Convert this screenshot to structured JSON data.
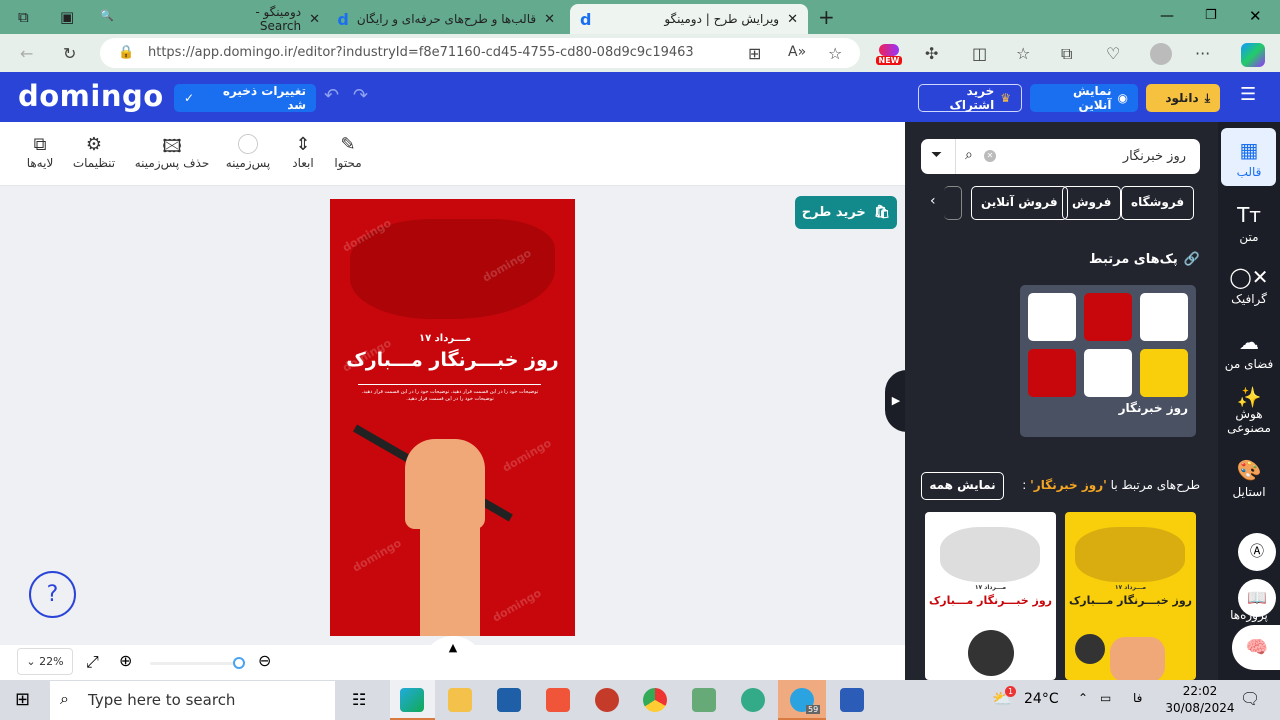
{
  "browser": {
    "tabs": [
      {
        "label": "دومینگو - Search",
        "active": false
      },
      {
        "label": "قالب‌ها و طرح‌های حرفه‌ای و رایگان",
        "active": false
      },
      {
        "label": "ویرایش طرح | دومینگو",
        "active": true
      }
    ],
    "url": "https://app.domingo.ir/editor?industryId=f8e71160-cd45-4755-cd80-08d9c9c19463",
    "url_host": "app.domingo.ir",
    "new_badge": "NEW"
  },
  "header": {
    "logo": "domingo",
    "saved": "تغییرات ذخیره شد",
    "download": "دانلود",
    "preview": "نمایش آنلاین",
    "subscribe": "خرید اشتراک"
  },
  "toolbar": [
    {
      "label": "محتوا",
      "icon": "pencil-icon"
    },
    {
      "label": "ابعاد",
      "icon": "resize-icon"
    },
    {
      "label": "پس‌زمینه",
      "icon": "background-color-icon"
    },
    {
      "label": "حذف پس‌زمینه",
      "icon": "remove-background-icon"
    },
    {
      "label": "تنظیمات",
      "icon": "gear-icon"
    },
    {
      "label": "لایه‌ها",
      "icon": "layers-icon"
    }
  ],
  "canvas": {
    "buy_design": "خرید طرح",
    "design": {
      "date": "۱۷ مـــرداد",
      "title": "روز خبـــرنگار مـــبارک",
      "body": "توضیحات خود را در این قسمت قرار دهید. توضیحات خود را در این قسمت قرار دهید. توضیحات خود را در این قسمت قرار دهید.",
      "watermark": "domingo",
      "bg_color": "#c8070c"
    },
    "help": "?",
    "zoom": "22%",
    "zoom_level": 0.22
  },
  "panel": {
    "search_value": "روز خبرنگار",
    "chips": [
      "فروشگاه",
      "فروش",
      "فروش آنلاین"
    ],
    "packs_title": "پک‌های مرتبط",
    "pack_name": "روز خبرنگار",
    "related_prefix": "طرح‌های مرتبط با",
    "related_term": "'روز خبرنگار'",
    "related_suffix": ":",
    "show_all": "نمایش همه",
    "cards": [
      {
        "date": "۱۷ مـــرداد",
        "title": "روز خبـــرنگار مـــبارک",
        "bg": "#ffffff",
        "title_color": "#c8070c"
      },
      {
        "date": "۱۷ مـــرداد",
        "title": "روز خبـــرنگار مـــبارک",
        "bg": "#f8cf0a",
        "title_color": "#222222"
      }
    ]
  },
  "sidebar": [
    {
      "label": "قالب",
      "icon": "template-icon",
      "active": true
    },
    {
      "label": "متن",
      "icon": "text-icon"
    },
    {
      "label": "گرافیک",
      "icon": "shapes-icon"
    },
    {
      "label": "فضای من",
      "icon": "cloud-upload-icon"
    },
    {
      "label": "هوش مصنوعی",
      "icon": "magic-wand-icon"
    },
    {
      "label": "استایل",
      "icon": "palette-icon"
    },
    {
      "label": "پروژه‌ها",
      "icon": "book-icon"
    }
  ],
  "taskbar": {
    "search_placeholder": "Type here to search",
    "temperature": "24°C",
    "weather_badge": "1",
    "language": "فا",
    "time": "22:02",
    "date": "30/08/2024",
    "telegram_badge": "59"
  }
}
